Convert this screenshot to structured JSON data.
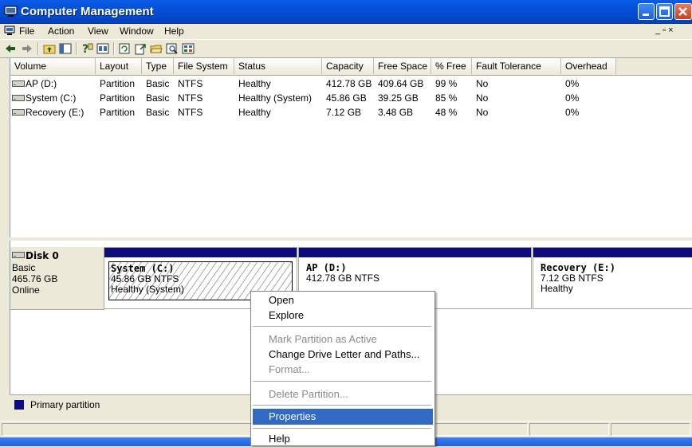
{
  "window": {
    "title": "Computer Management",
    "min_label": "_",
    "max_label": "□",
    "close_label": "×"
  },
  "menubar": {
    "items": [
      "File",
      "Action",
      "View",
      "Window",
      "Help"
    ],
    "mdi_controls": "_ ▫ ×"
  },
  "toolbar": {
    "icons": [
      "back-arrow-icon",
      "forward-arrow-icon",
      "up-folder-icon",
      "show-hide-tree-icon",
      "help-icon",
      "properties-icon",
      "refresh-icon",
      "export-icon",
      "open-folder-icon",
      "search-icon",
      "disk-settings-icon"
    ]
  },
  "volume_list": {
    "columns": [
      "Volume",
      "Layout",
      "Type",
      "File System",
      "Status",
      "Capacity",
      "Free Space",
      "% Free",
      "Fault Tolerance",
      "Overhead"
    ],
    "rows": [
      {
        "volume": "AP (D:)",
        "layout": "Partition",
        "type": "Basic",
        "fs": "NTFS",
        "status": "Healthy",
        "capacity": "412.78 GB",
        "free": "409.64 GB",
        "pct": "99 %",
        "fault": "No",
        "overhead": "0%"
      },
      {
        "volume": "System (C:)",
        "layout": "Partition",
        "type": "Basic",
        "fs": "NTFS",
        "status": "Healthy (System)",
        "capacity": "45.86 GB",
        "free": "39.25 GB",
        "pct": "85 %",
        "fault": "No",
        "overhead": "0%"
      },
      {
        "volume": "Recovery (E:)",
        "layout": "Partition",
        "type": "Basic",
        "fs": "NTFS",
        "status": "Healthy",
        "capacity": "7.12 GB",
        "free": "3.48 GB",
        "pct": "48 %",
        "fault": "No",
        "overhead": "0%"
      }
    ]
  },
  "disk": {
    "name": "Disk 0",
    "type": "Basic",
    "size": "465.76 GB",
    "state": "Online",
    "partitions": [
      {
        "name": "System  (C:)",
        "size": "45.86 GB NTFS",
        "status": "Healthy (System)"
      },
      {
        "name": "AP  (D:)",
        "size": "412.78 GB NTFS",
        "status": ""
      },
      {
        "name": "Recovery  (E:)",
        "size": "7.12 GB NTFS",
        "status": "Healthy"
      }
    ]
  },
  "legend": {
    "label": "Primary partition",
    "color": "#0c0c7e"
  },
  "context_menu": {
    "items": [
      {
        "label": "Open",
        "enabled": true
      },
      {
        "label": "Explore",
        "enabled": true
      },
      {
        "label": "Mark Partition as Active",
        "enabled": false
      },
      {
        "label": "Change Drive Letter and Paths...",
        "enabled": true
      },
      {
        "label": "Format...",
        "enabled": false
      },
      {
        "label": "Delete Partition...",
        "enabled": false
      },
      {
        "label": "Properties",
        "enabled": true,
        "selected": true
      },
      {
        "label": "Help",
        "enabled": true
      }
    ]
  },
  "colors": {
    "titlebar": "#0350d8",
    "selection": "#316ac5",
    "partition_bar": "#0c0c7e"
  }
}
